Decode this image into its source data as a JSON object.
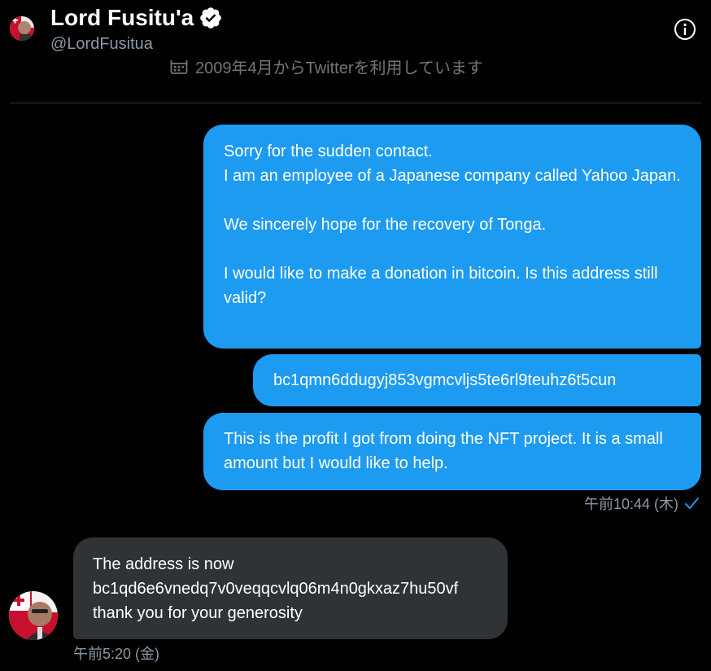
{
  "header": {
    "display_name": "Lord Fusitu'a",
    "handle": "@LordFusitua",
    "joined_text": "2009年4月からTwitterを利用しています",
    "verified_icon": "verified-badge-icon",
    "info_icon": "info-circle-icon",
    "calendar_icon": "calendar-icon"
  },
  "colors": {
    "background": "#000000",
    "sent_bubble": "#1d9bf0",
    "received_bubble": "#2f3336",
    "meta_text": "#8b98a5",
    "divider": "#2f3336"
  },
  "messages": [
    {
      "direction": "sent",
      "text": "Sorry for the sudden contact.\nI am an employee of a Japanese company called Yahoo Japan.\n\nWe sincerely hope for the recovery of Tonga.\n\nI would like to make a donation in bitcoin. Is this address still valid?"
    },
    {
      "direction": "sent",
      "text": "bc1qmn6ddugyj853vgmcvljs5te6rl9teuhz6t5cun"
    },
    {
      "direction": "sent",
      "text": "This is the profit I got from doing the NFT project. It is a small amount but I would like to help."
    },
    {
      "direction": "received",
      "text": "The address is now bc1qd6e6vnedq7v0veqqcvlq06m4n0gkxaz7hu50vf thank you for your generosity"
    }
  ],
  "sent_meta": {
    "timestamp": "午前10:44 (木)",
    "status_icon": "read-check-icon"
  },
  "received_meta": {
    "timestamp": "午前5:20 (金)"
  }
}
